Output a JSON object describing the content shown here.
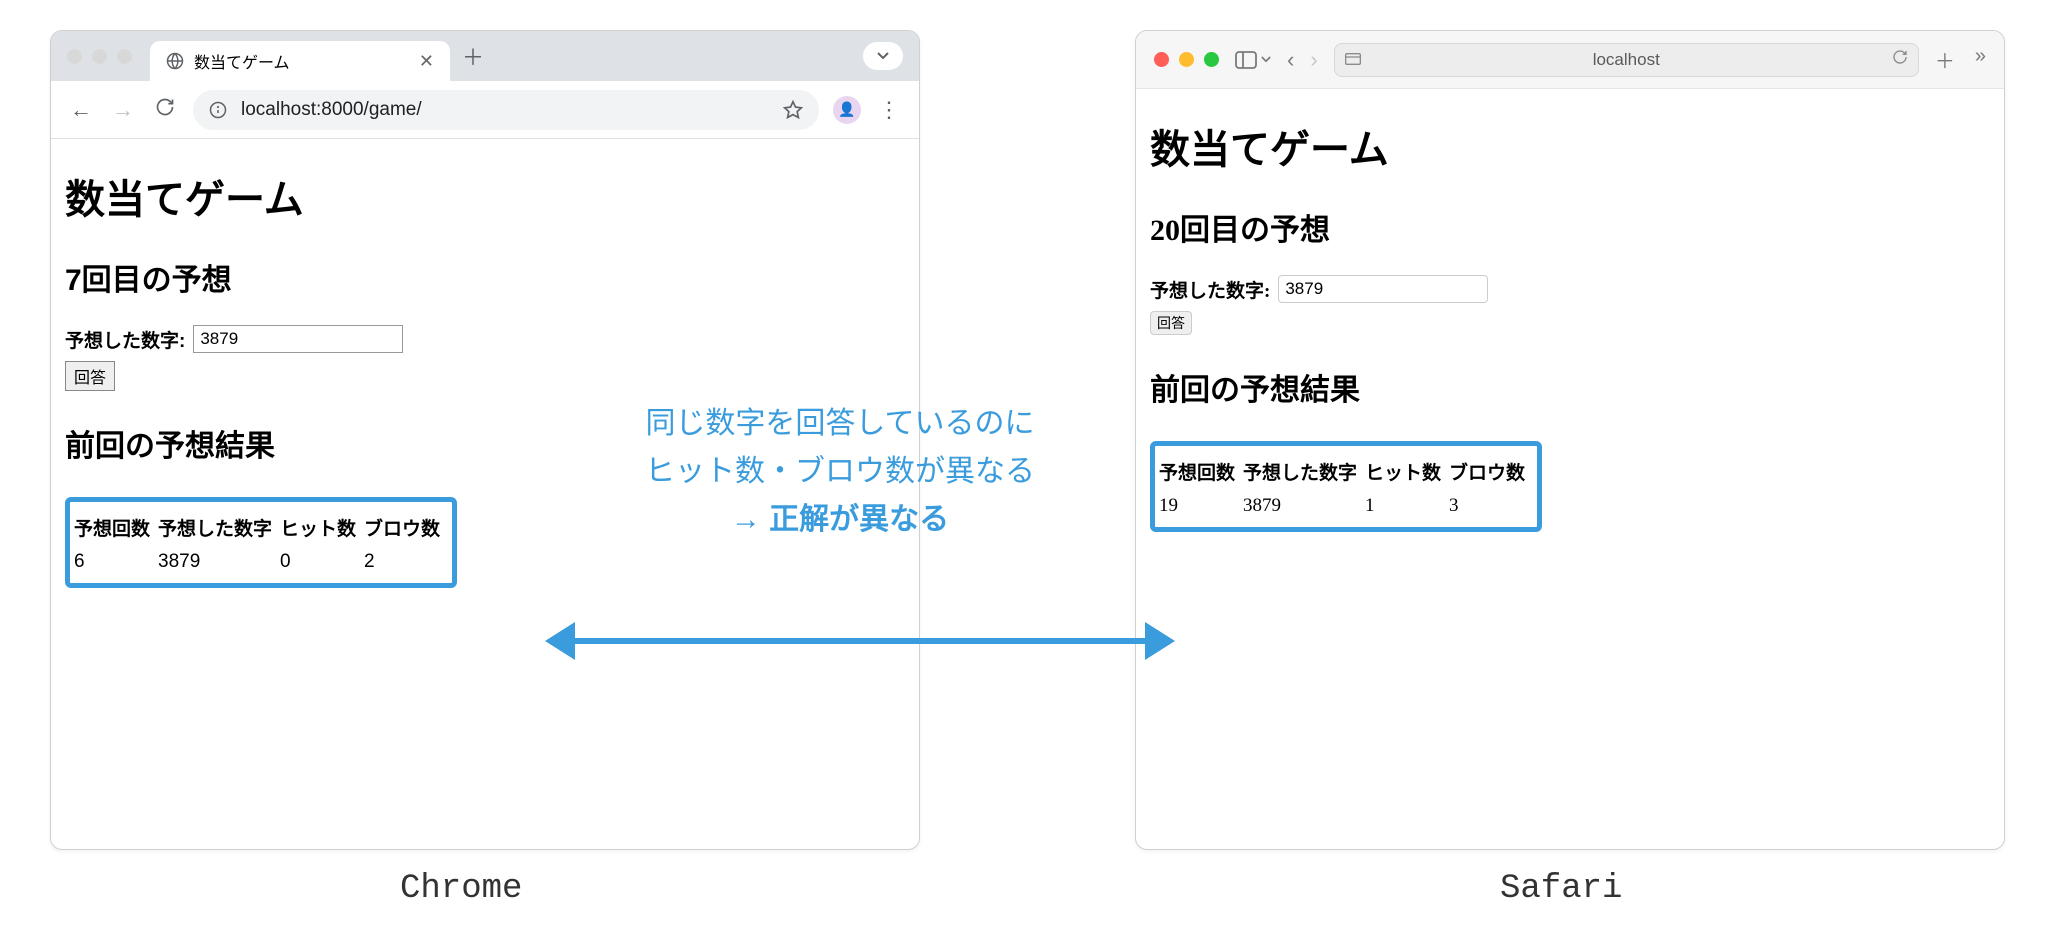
{
  "chrome": {
    "tab_title": "数当てゲーム",
    "url": "localhost:8000/game/",
    "page": {
      "title": "数当てゲーム",
      "guess_heading": "7回目の予想",
      "form_label": "予想した数字:",
      "input_value": "3879",
      "submit_label": "回答",
      "result_heading": "前回の予想結果",
      "table_headers": [
        "予想回数",
        "予想した数字",
        "ヒット数",
        "ブロウ数"
      ],
      "table_row": [
        "6",
        "3879",
        "0",
        "2"
      ]
    }
  },
  "safari": {
    "url": "localhost",
    "page": {
      "title": "数当てゲーム",
      "guess_heading": "20回目の予想",
      "form_label": "予想した数字:",
      "input_value": "3879",
      "submit_label": "回答",
      "result_heading": "前回の予想結果",
      "table_headers": [
        "予想回数",
        "予想した数字",
        "ヒット数",
        "ブロウ数"
      ],
      "table_row": [
        "19",
        "3879",
        "1",
        "3"
      ]
    }
  },
  "annotation": {
    "line1": "同じ数字を回答しているのに",
    "line2": "ヒット数・ブロウ数が異なる",
    "line3_prefix": "→ ",
    "line3_bold": "正解が異なる"
  },
  "labels": {
    "chrome": "Chrome",
    "safari": "Safari"
  }
}
